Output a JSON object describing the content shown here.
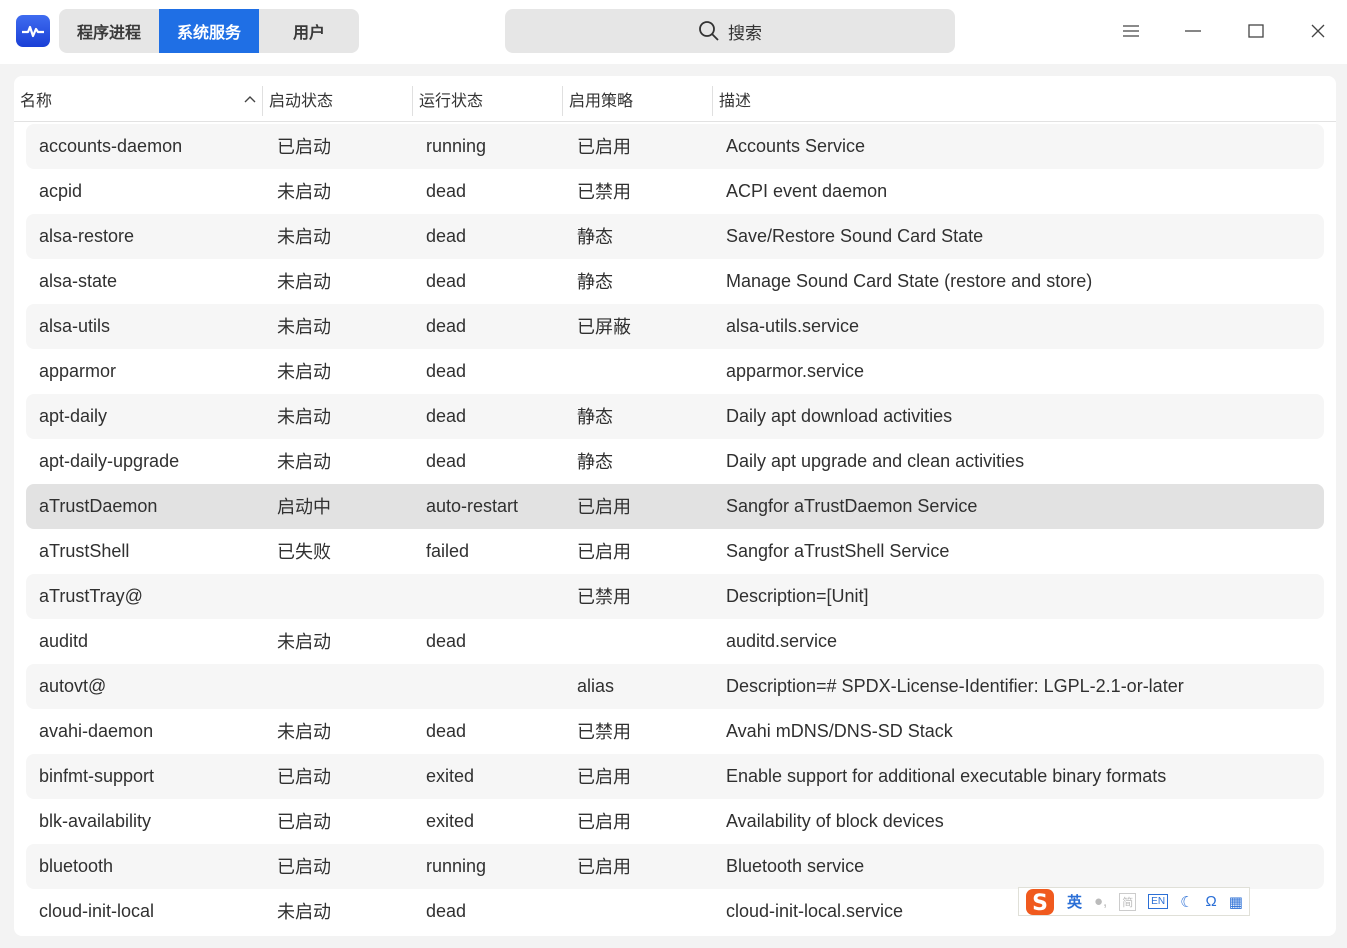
{
  "app": {
    "icon": "activity-monitor-icon"
  },
  "tabs": [
    {
      "label": "程序进程"
    },
    {
      "label": "系统服务",
      "active": true
    },
    {
      "label": "用户"
    }
  ],
  "search": {
    "placeholder": "搜索"
  },
  "columns": [
    "名称",
    "启动状态",
    "运行状态",
    "启用策略",
    "描述"
  ],
  "rows": [
    [
      "accounts-daemon",
      "已启动",
      "running",
      "已启用",
      "Accounts Service"
    ],
    [
      "acpid",
      "未启动",
      "dead",
      "已禁用",
      "ACPI event daemon"
    ],
    [
      "alsa-restore",
      "未启动",
      "dead",
      "静态",
      "Save/Restore Sound Card State"
    ],
    [
      "alsa-state",
      "未启动",
      "dead",
      "静态",
      "Manage Sound Card State (restore and store)"
    ],
    [
      "alsa-utils",
      "未启动",
      "dead",
      "已屏蔽",
      "alsa-utils.service"
    ],
    [
      "apparmor",
      "未启动",
      "dead",
      "",
      "apparmor.service"
    ],
    [
      "apt-daily",
      "未启动",
      "dead",
      "静态",
      "Daily apt download activities"
    ],
    [
      "apt-daily-upgrade",
      "未启动",
      "dead",
      "静态",
      "Daily apt upgrade and clean activities"
    ],
    [
      "aTrustDaemon",
      "启动中",
      "auto-restart",
      "已启用",
      "Sangfor aTrustDaemon Service"
    ],
    [
      "aTrustShell",
      "已失败",
      "failed",
      "已启用",
      "Sangfor aTrustShell Service"
    ],
    [
      "aTrustTray@",
      "",
      "",
      "已禁用",
      "Description=[Unit]"
    ],
    [
      "auditd",
      "未启动",
      "dead",
      "",
      "auditd.service"
    ],
    [
      "autovt@",
      "",
      "",
      "alias",
      "Description=#  SPDX-License-Identifier: LGPL-2.1-or-later"
    ],
    [
      "avahi-daemon",
      "未启动",
      "dead",
      "已禁用",
      "Avahi mDNS/DNS-SD Stack"
    ],
    [
      "binfmt-support",
      "已启动",
      "exited",
      "已启用",
      "Enable support for additional executable binary formats"
    ],
    [
      "blk-availability",
      "已启动",
      "exited",
      "已启用",
      "Availability of block devices"
    ],
    [
      "bluetooth",
      "已启动",
      "running",
      "已启用",
      "Bluetooth service"
    ],
    [
      "cloud-init-local",
      "未启动",
      "dead",
      "",
      "cloud-init-local.service"
    ]
  ],
  "selected_row": 8,
  "ime": {
    "mode": "英",
    "simplified": "简",
    "layout": "EN"
  }
}
